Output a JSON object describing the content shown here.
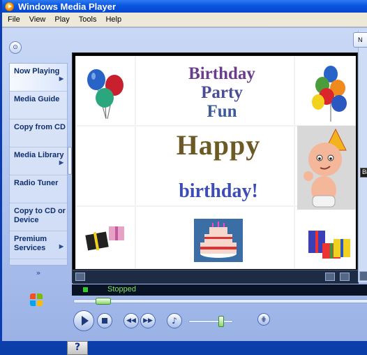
{
  "window": {
    "title": "Windows Media Player"
  },
  "menu": [
    "File",
    "View",
    "Play",
    "Tools",
    "Help"
  ],
  "taskpane": {
    "items": [
      {
        "label": "Now Playing",
        "has_arrow": true,
        "active": true
      },
      {
        "label": "Media Guide",
        "has_arrow": false
      },
      {
        "label": "Copy from CD",
        "has_arrow": false
      },
      {
        "label": "Media Library",
        "has_arrow": true
      },
      {
        "label": "Radio Tuner",
        "has_arrow": false
      },
      {
        "label": "Copy to CD or Device",
        "has_arrow": false
      },
      {
        "label": "Premium Services",
        "has_arrow": true
      }
    ],
    "more": "»"
  },
  "player": {
    "visualization": {
      "headline1": [
        "Birthday",
        "Party",
        "Fun"
      ],
      "headline2": "Happy",
      "headline3": "birthday!"
    },
    "status": "Stopped"
  },
  "right_panel": {
    "tab_text": "N",
    "tab2_text": "Bi"
  },
  "icons": {
    "back": "back-icon",
    "play": "play-icon",
    "stop": "stop-icon",
    "prev": "previous-icon",
    "next": "next-icon",
    "mute": "speaker-icon",
    "eq": "equalizer-icon"
  },
  "colors": {
    "titlebar": "#0a55e0",
    "status_text": "#7ee25b",
    "player_bg": "#000000"
  }
}
